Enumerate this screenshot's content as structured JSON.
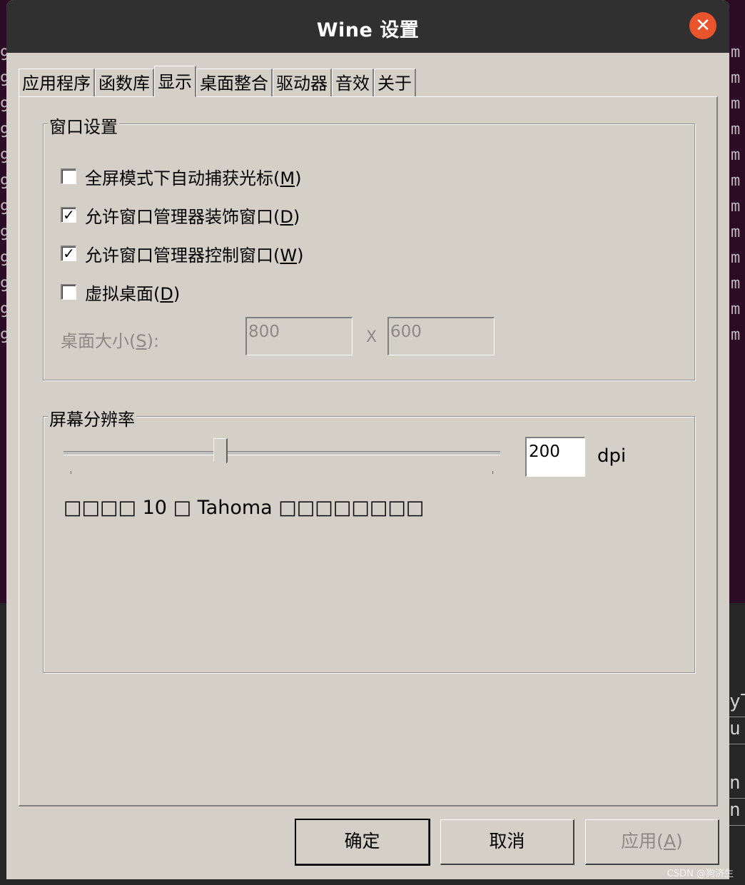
{
  "window": {
    "title": "Wine 设置",
    "close_symbol": "✕"
  },
  "tabs": [
    {
      "label": "应用程序"
    },
    {
      "label": "函数库"
    },
    {
      "label": "显示"
    },
    {
      "label": "桌面整合"
    },
    {
      "label": "驱动器"
    },
    {
      "label": "音效"
    },
    {
      "label": "关于"
    }
  ],
  "window_settings": {
    "title": "窗口设置",
    "options": [
      {
        "label": "全屏模式下自动捕获光标(",
        "mnemonic": "M",
        "label_end": ")",
        "checked": false
      },
      {
        "label": "允许窗口管理器装饰窗口(",
        "mnemonic": "D",
        "label_end": ")",
        "checked": true
      },
      {
        "label": "允许窗口管理器控制窗口(",
        "mnemonic": "W",
        "label_end": ")",
        "checked": true
      },
      {
        "label": "虚拟桌面(",
        "mnemonic": "D",
        "label_end": ")",
        "checked": false
      }
    ],
    "desktop_size_label": "桌面大小(",
    "desktop_size_mnemonic": "S",
    "desktop_size_label_end": "):",
    "width": "800",
    "separator": "X",
    "height": "600"
  },
  "resolution": {
    "title": "屏幕分辨率",
    "dpi_value": "200",
    "dpi_unit": "dpi",
    "slider_fraction": 0.36,
    "font_sample": "□□□□ 10 □ Tahoma □□□□□□□□"
  },
  "buttons": {
    "ok": "确定",
    "cancel": "取消",
    "apply": "应用(",
    "apply_mnemonic": "A",
    "apply_end": ")"
  },
  "background": {
    "right_fragments": [
      "yT",
      "u",
      "n",
      "n"
    ]
  },
  "watermark": "CSDN @狗济生"
}
